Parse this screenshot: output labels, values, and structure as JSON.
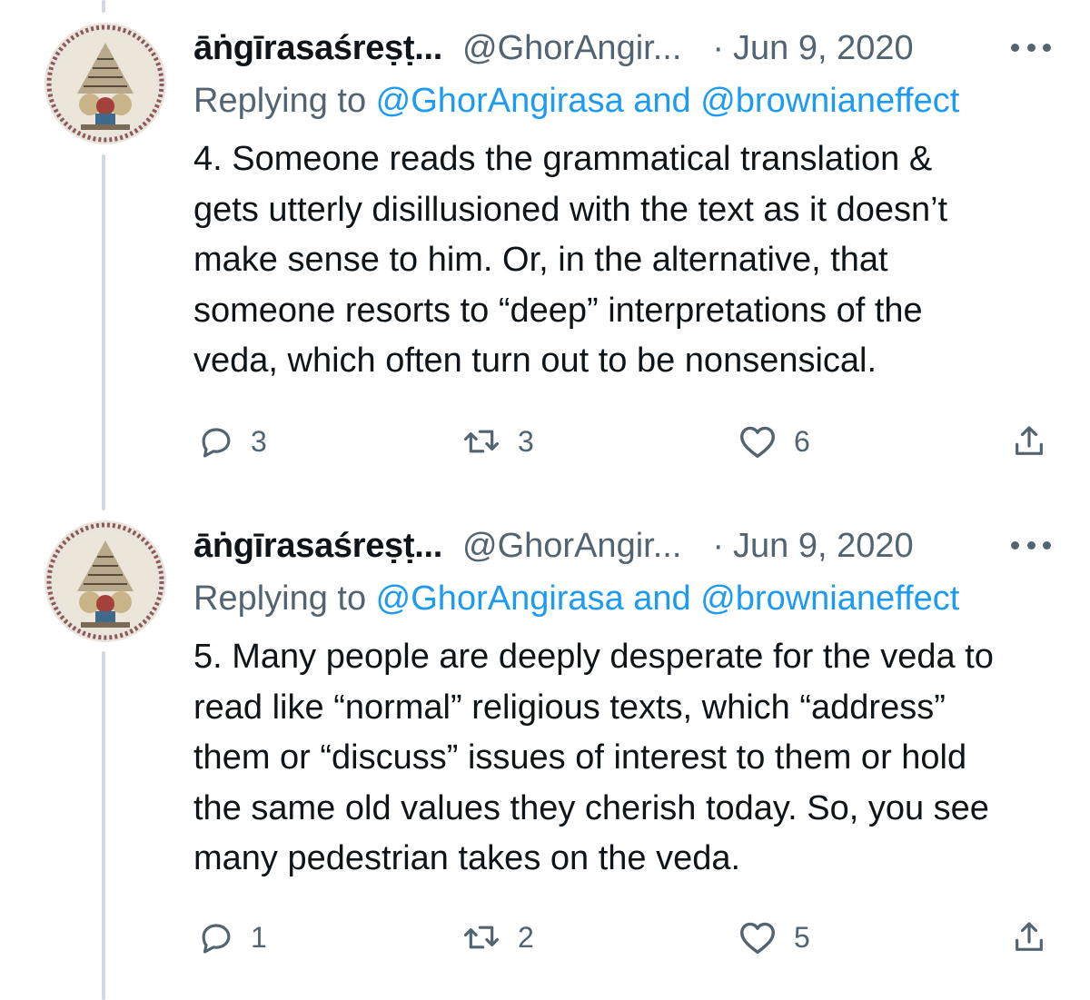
{
  "tweets": [
    {
      "display_name": "āṅgīrasaśreṣṭ...",
      "handle": "@GhorAngir...",
      "separator": "·",
      "date": "Jun 9, 2020",
      "reply_prefix": "Replying to",
      "reply_mentions": "@GhorAngirasa and @brownianeffect",
      "text_lines": [
        "4. Someone reads the grammatical translation &",
        "gets utterly disillusioned with the text as it doesn’t",
        "make sense to him. Or, in the alternative, that",
        "someone resorts to “deep” interpretations of the",
        "veda, which often turn out to be nonsensical."
      ],
      "replies": "3",
      "retweets": "3",
      "likes": "6"
    },
    {
      "display_name": "āṅgīrasaśreṣṭ...",
      "handle": "@GhorAngir...",
      "separator": "·",
      "date": "Jun 9, 2020",
      "reply_prefix": "Replying to",
      "reply_mentions": "@GhorAngirasa and @brownianeffect",
      "text_lines": [
        "5. Many people are deeply desperate for the veda to",
        "read like “normal” religious texts, which “address”",
        "them or “discuss” issues of interest to them or hold",
        "the same old values they cherish today. So, you see",
        "many pedestrian takes on the veda."
      ],
      "replies": "1",
      "retweets": "2",
      "likes": "5"
    }
  ],
  "icons": {
    "reply": "reply-icon",
    "retweet": "retweet-icon",
    "like": "heart-icon",
    "share": "share-icon",
    "more": "more-icon"
  },
  "colors": {
    "text": "#0f1419",
    "secondary": "#536471",
    "link": "#1d9bf0",
    "thread_line": "#cfd9de"
  }
}
